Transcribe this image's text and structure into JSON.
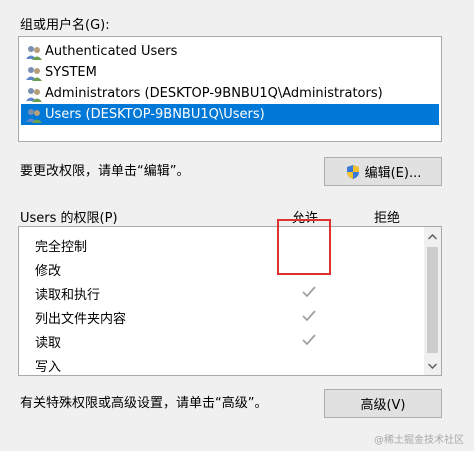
{
  "group_users": {
    "label": "组或用户名(G):",
    "items": [
      {
        "name": "Authenticated Users",
        "selected": false
      },
      {
        "name": "SYSTEM",
        "selected": false
      },
      {
        "name": "Administrators (DESKTOP-9BNBU1Q\\Administrators)",
        "selected": false
      },
      {
        "name": "Users (DESKTOP-9BNBU1Q\\Users)",
        "selected": true
      }
    ]
  },
  "change_hint": "要更改权限，请单击“编辑”。",
  "edit_button": "编辑(E)...",
  "permissions": {
    "title": "Users 的权限(P)",
    "allow_header": "允许",
    "deny_header": "拒绝",
    "items": [
      {
        "name": "完全控制",
        "allow": false,
        "deny": false
      },
      {
        "name": "修改",
        "allow": false,
        "deny": false
      },
      {
        "name": "读取和执行",
        "allow": true,
        "deny": false
      },
      {
        "name": "列出文件夹内容",
        "allow": true,
        "deny": false
      },
      {
        "name": "读取",
        "allow": true,
        "deny": false
      },
      {
        "name": "写入",
        "allow": false,
        "deny": false
      }
    ]
  },
  "advanced_hint": "有关特殊权限或高级设置，请单击“高级”。",
  "advanced_button": "高级(V)",
  "watermark": "@稀土掘金技术社区",
  "colors": {
    "selection": "#0078d7",
    "highlight_box": "#e03131",
    "check_gray": "#a0a0a0"
  }
}
